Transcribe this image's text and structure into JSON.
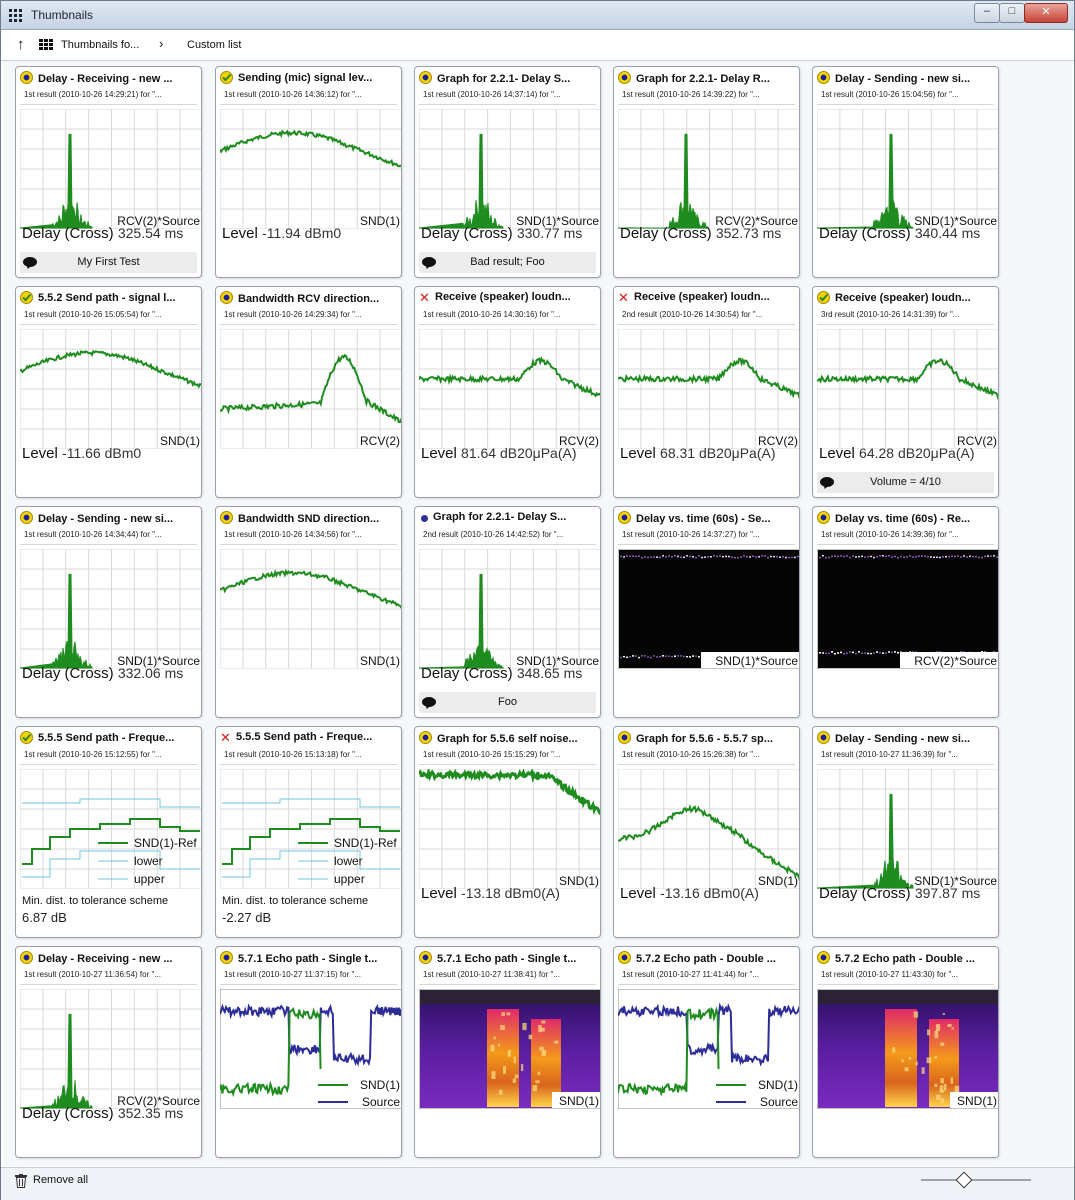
{
  "window": {
    "title": "Thumbnails"
  },
  "nav": {
    "crumb1": "Thumbnails fo...",
    "crumb2": "Custom list"
  },
  "footer": {
    "remove_all": "Remove all",
    "zoom_level": 0.38
  },
  "colors": {
    "plot_green": "#1f8c1f",
    "grid": "#d9d9d9",
    "echo_blue": "#2d2d9a"
  },
  "cards": [
    {
      "status": "info",
      "title": "Delay - Receiving - new ...",
      "subtitle": "1st result (2010-10-26 14:29:21) for \"...",
      "plot": "impulse",
      "plot_label": "RCV(2)*Source",
      "measure": "Delay (Cross)",
      "value": "325.54 ms",
      "comment": "My First Test"
    },
    {
      "status": "pass",
      "title": "Sending (mic) signal lev...",
      "subtitle": "1st result (2010-10-26 14:36:12) for \"...",
      "plot": "level",
      "plot_label": "SND(1)",
      "measure": "Level",
      "value": "-11.94 dBm0",
      "comment": ""
    },
    {
      "status": "info",
      "title": "Graph for 2.2.1- Delay S...",
      "subtitle": "1st result (2010-10-26 14:37:14) for \"...",
      "plot": "impulse",
      "plot_label": "SND(1)*Source",
      "measure": "Delay (Cross)",
      "value": "330.77 ms",
      "comment": "Bad result; Foo"
    },
    {
      "status": "info",
      "title": "Graph for 2.2.1-  Delay R...",
      "subtitle": "1st result (2010-10-26 14:39:22) for \"...",
      "plot": "impulse",
      "plot_label": "RCV(2)*Source",
      "measure": "Delay (Cross)",
      "value": "352.73 ms",
      "comment": ""
    },
    {
      "status": "info",
      "title": "Delay - Sending - new si...",
      "subtitle": "1st result (2010-10-26 15:04:56) for \"...",
      "plot": "impulse",
      "plot_label": "SND(1)*Source",
      "measure": "Delay (Cross)",
      "value": "340.44 ms",
      "comment": ""
    },
    {
      "status": "pass",
      "title": "5.5.2 Send path - signal l...",
      "subtitle": "1st result (2010-10-26 15:05:54) for \"...",
      "plot": "level",
      "plot_label": "SND(1)",
      "measure": "Level",
      "value": "-11.66 dBm0",
      "comment": ""
    },
    {
      "status": "info",
      "title": "Bandwidth RCV direction...",
      "subtitle": "1st result (2010-10-26 14:29:34) for \"...",
      "plot": "bandwidth",
      "plot_label": "RCV(2)",
      "measure": "",
      "value": "",
      "comment": ""
    },
    {
      "status": "fail",
      "title": "Receive (speaker) loudn...",
      "subtitle": "1st result (2010-10-26 14:30:16) for \"...",
      "plot": "loud",
      "plot_label": "RCV(2)",
      "measure": "Level",
      "value": "81.64 dB20μPa(A)",
      "comment": ""
    },
    {
      "status": "fail",
      "title": "Receive (speaker) loudn...",
      "subtitle": "2nd result (2010-10-26 14:30:54) for \"...",
      "plot": "loud",
      "plot_label": "RCV(2)",
      "measure": "Level",
      "value": "68.31 dB20μPa(A)",
      "comment": ""
    },
    {
      "status": "pass",
      "title": "Receive (speaker) loudn...",
      "subtitle": "3rd result (2010-10-26 14:31:39) for \"...",
      "plot": "loud",
      "plot_label": "RCV(2)",
      "measure": "Level",
      "value": "64.28 dB20μPa(A)",
      "comment": "Volume = 4/10"
    },
    {
      "status": "info",
      "title": "Delay - Sending - new si...",
      "subtitle": "1st result (2010-10-26 14:34:44) for \"...",
      "plot": "impulse",
      "plot_label": "SND(1)*Source",
      "measure": "Delay (Cross)",
      "value": "332.06 ms",
      "comment": ""
    },
    {
      "status": "info",
      "title": "Bandwidth SND direction...",
      "subtitle": "1st result (2010-10-26 14:34:56) for \"...",
      "plot": "level",
      "plot_label": "SND(1)",
      "measure": "",
      "value": "",
      "comment": ""
    },
    {
      "status": "dot",
      "title": "Graph for 2.2.1- Delay S...",
      "subtitle": "2nd result (2010-10-26 14:42:52) for \"...",
      "plot": "impulse",
      "plot_label": "SND(1)*Source",
      "measure": "Delay (Cross)",
      "value": "348.65 ms",
      "comment": "Foo"
    },
    {
      "status": "info",
      "title": "Delay vs. time (60s) - Se...",
      "subtitle": "1st result (2010-10-26 14:37:27) for \"...",
      "plot": "dark",
      "plot_label": "SND(1)*Source",
      "measure": "",
      "value": "",
      "comment": ""
    },
    {
      "status": "info",
      "title": "Delay vs. time (60s) - Re...",
      "subtitle": "1st result (2010-10-26 14:39:36) for \"...",
      "plot": "dark",
      "plot_label": "RCV(2)*Source",
      "measure": "",
      "value": "",
      "comment": ""
    },
    {
      "status": "pass",
      "title": "5.5.5 Send path - Freque...",
      "subtitle": "1st result (2010-10-26 15:12:55) for \"...",
      "plot": "tolerance",
      "plot_label": "",
      "legend": [
        "SND(1)-Ref",
        "lower",
        "upper"
      ],
      "measure": "Min. dist. to tolerance scheme",
      "value": "6.87 dB",
      "comment": ""
    },
    {
      "status": "fail",
      "title": "5.5.5 Send path - Freque...",
      "subtitle": "1st result (2010-10-26 15:13:18) for \"...",
      "plot": "tolerance",
      "plot_label": "",
      "legend": [
        "SND(1)-Ref",
        "lower",
        "upper"
      ],
      "measure": "Min. dist. to tolerance scheme",
      "value": "-2.27 dB",
      "comment": ""
    },
    {
      "status": "info",
      "title": "Graph for 5.5.6 self noise...",
      "subtitle": "1st result (2010-10-26 15:15:29) for \"...",
      "plot": "noise",
      "plot_label": "SND(1)",
      "measure": "Level",
      "value": "-13.18 dBm0(A)",
      "comment": ""
    },
    {
      "status": "info",
      "title": "Graph for 5.5.6 - 5.5.7 sp...",
      "subtitle": "1st result (2010-10-26 15:26:38) for \"...",
      "plot": "bump",
      "plot_label": "SND(1)",
      "measure": "Level",
      "value": "-13.16 dBm0(A)",
      "comment": ""
    },
    {
      "status": "info",
      "title": "Delay - Sending - new si...",
      "subtitle": "1st result (2010-10-27 11:36:39) for \"...",
      "plot": "impulse",
      "plot_label": "SND(1)*Source",
      "measure": "Delay (Cross)",
      "value": "397.87 ms",
      "comment": ""
    },
    {
      "status": "info",
      "title": "Delay - Receiving - new ...",
      "subtitle": "1st result (2010-10-27 11:36:54) for \"...",
      "plot": "impulse",
      "plot_label": "RCV(2)*Source",
      "measure": "Delay (Cross)",
      "value": "352.35 ms",
      "comment": ""
    },
    {
      "status": "info",
      "title": "5.7.1 Echo path - Single t...",
      "subtitle": "1st result (2010-10-27 11:37:15) for \"...",
      "plot": "echo",
      "plot_label": "",
      "legend": [
        "SND(1)",
        "Source"
      ],
      "measure": "",
      "value": "",
      "comment": ""
    },
    {
      "status": "info",
      "title": "5.7.1 Echo path - Single t...",
      "subtitle": "1st result (2010-10-27 11:38:41) for \"...",
      "plot": "spectro",
      "plot_label": "SND(1)",
      "measure": "",
      "value": "",
      "comment": ""
    },
    {
      "status": "info",
      "title": "5.7.2 Echo path - Double ...",
      "subtitle": "1st result (2010-10-27 11:41:44) for \"...",
      "plot": "echo",
      "plot_label": "",
      "legend": [
        "SND(1)",
        "Source"
      ],
      "measure": "",
      "value": "",
      "comment": ""
    },
    {
      "status": "info",
      "title": "5.7.2 Echo path - Double ...",
      "subtitle": "1st result (2010-10-27 11:43:30) for \"...",
      "plot": "spectro",
      "plot_label": "SND(1)",
      "measure": "",
      "value": "",
      "comment": ""
    }
  ]
}
